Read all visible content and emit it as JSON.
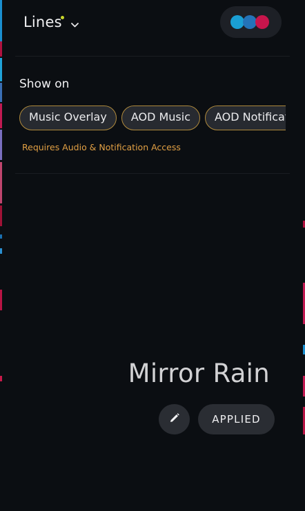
{
  "header": {
    "theme_title": "Lines"
  },
  "palette": {
    "colors": [
      "#1a9fd4",
      "#2473b8",
      "#c8154c"
    ]
  },
  "settings": {
    "section_title": "Show on",
    "chips": [
      "Music Overlay",
      "AOD Music",
      "AOD Notification"
    ],
    "requirement_note": "Requires Audio & Notification Access"
  },
  "preview": {
    "style_name": "Mirror Rain",
    "applied_label": "APPLIED"
  },
  "icons": [
    "chevron-down-icon",
    "pencil-icon"
  ],
  "colors": {
    "accent_border": "#b08a3c",
    "note_orange": "#e2a044",
    "new_dot": "#c8d62a"
  }
}
